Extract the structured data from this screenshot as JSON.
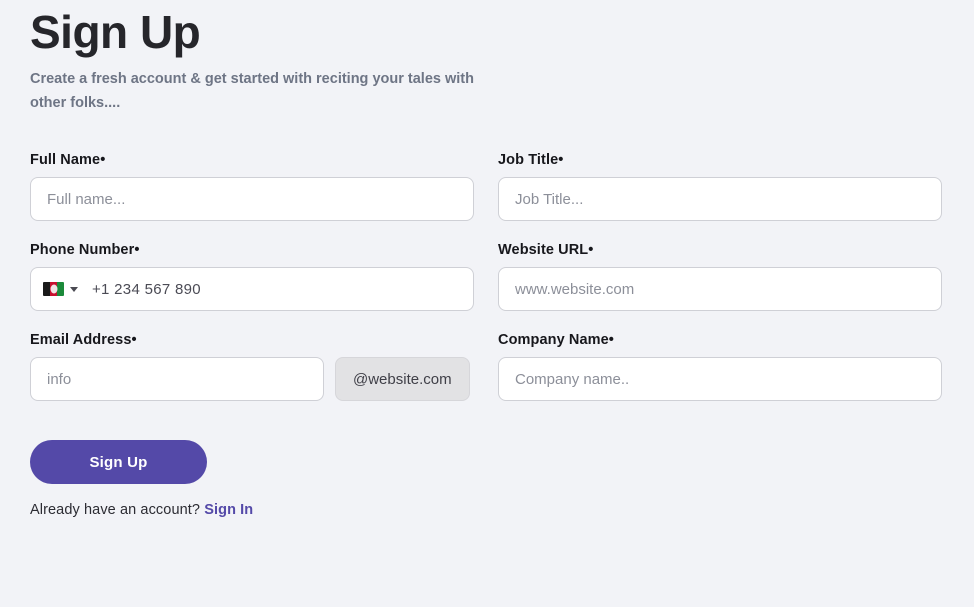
{
  "header": {
    "title": "Sign Up",
    "subtitle": "Create a fresh account & get started with reciting your tales with other folks...."
  },
  "form": {
    "required_marker": "•",
    "fields": {
      "full_name": {
        "label": "Full Name",
        "placeholder": "Full name...",
        "value": ""
      },
      "job_title": {
        "label": "Job Title",
        "placeholder": "Job Title...",
        "value": ""
      },
      "phone_number": {
        "label": "Phone Number",
        "placeholder": "+1 234 567 890",
        "value": "",
        "country_flag": "afghanistan-flag",
        "dropdown_icon": "chevron-down-icon"
      },
      "website_url": {
        "label": "Website URL",
        "placeholder": "www.website.com",
        "value": ""
      },
      "email_address": {
        "label": "Email Address",
        "placeholder": "info",
        "value": "",
        "addon": "@website.com"
      },
      "company_name": {
        "label": "Company Name",
        "placeholder": "Company name..",
        "value": ""
      }
    }
  },
  "footer": {
    "submit_label": "Sign Up",
    "signin_prompt": "Already have an account?",
    "signin_link": "Sign In"
  },
  "colors": {
    "background": "#f2f3f7",
    "accent": "#5449a8",
    "title": "#26262b",
    "subtitle": "#6e7585",
    "input_border": "#cfd0d6",
    "addon_background": "#e2e2e4"
  }
}
